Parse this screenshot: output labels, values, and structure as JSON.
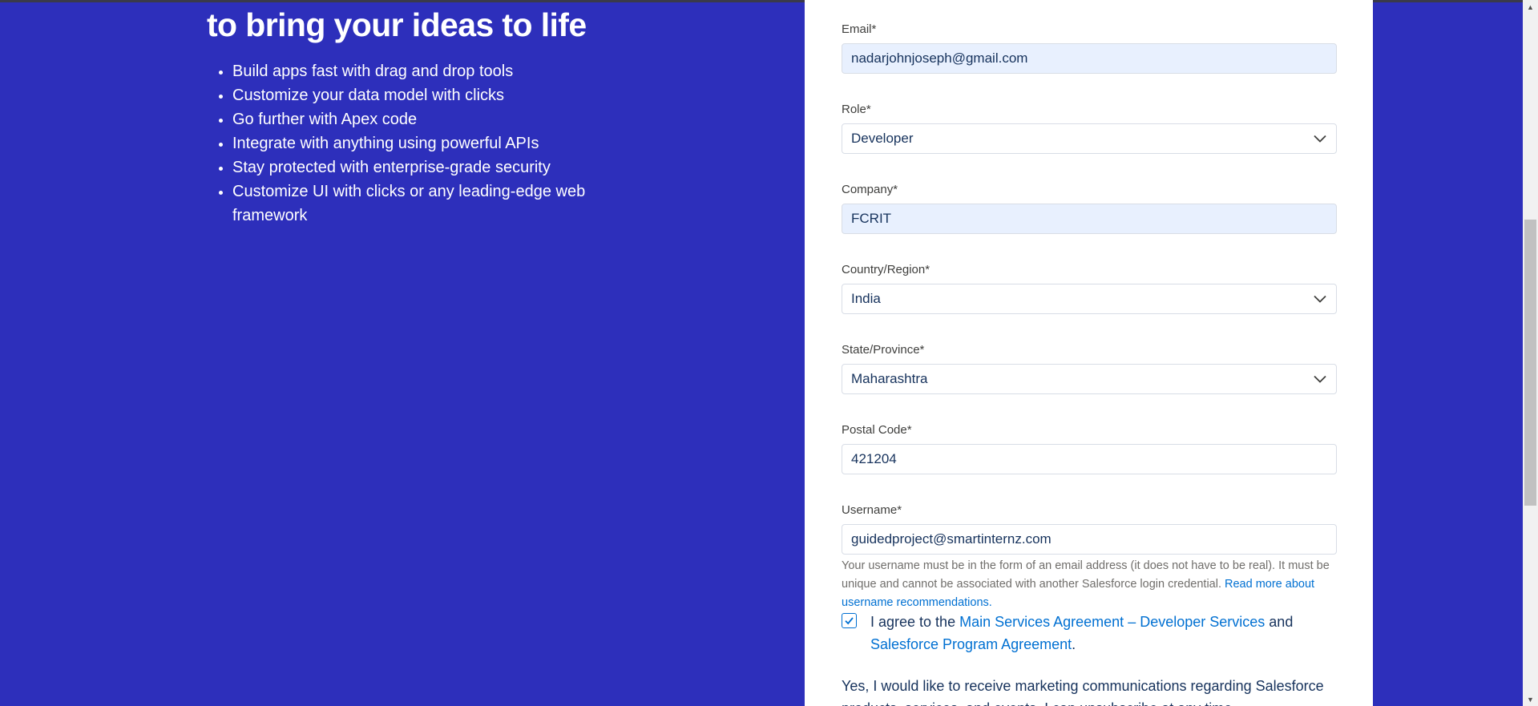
{
  "hero": {
    "title": "to bring your ideas to life",
    "features": [
      "Build apps fast with drag and drop tools",
      "Customize your data model with clicks",
      "Go further with Apex code",
      "Integrate with anything using powerful APIs",
      "Stay protected with enterprise-grade security",
      "Customize UI with clicks or any leading-edge web framework"
    ]
  },
  "form": {
    "email": {
      "label": "Email*",
      "value": "nadarjohnjoseph@gmail.com"
    },
    "role": {
      "label": "Role*",
      "value": "Developer"
    },
    "company": {
      "label": "Company*",
      "value": "FCRIT"
    },
    "country": {
      "label": "Country/Region*",
      "value": "India"
    },
    "state": {
      "label": "State/Province*",
      "value": "Maharashtra"
    },
    "postal": {
      "label": "Postal Code*",
      "value": "421204"
    },
    "username": {
      "label": "Username*",
      "value": "guidedproject@smartinternz.com"
    },
    "username_help": "Your username must be in the form of an email address (it does not have to be real). It must be unique and cannot be associated with another Salesforce login credential.",
    "username_help_link": "Read more about username recommendations.",
    "agree": {
      "prefix": "I agree to the",
      "link1": "Main Services Agreement – Developer Services",
      "middle": "and",
      "link2": "Salesforce Program Agreement",
      "suffix": "."
    },
    "marketing_text": "Yes, I would like to receive marketing communications regarding Salesforce products, services, and events. I can unsubscribe at any time."
  },
  "colors": {
    "background": "#2d2fbb",
    "link": "#0070d2",
    "autofill": "#e8f0fe"
  }
}
